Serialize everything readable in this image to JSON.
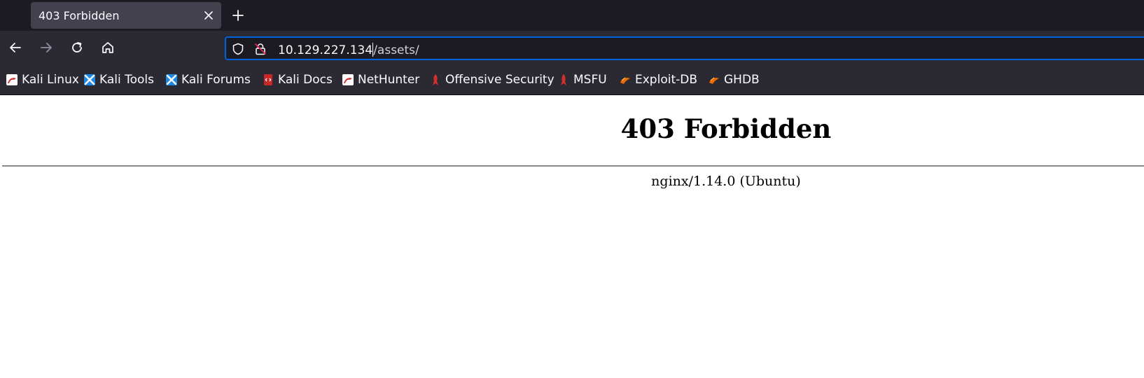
{
  "tab": {
    "title": "403 Forbidden"
  },
  "navbar": {
    "url_host": "10.129.227.134",
    "url_path": "/assets/"
  },
  "bookmarks": [
    {
      "label": "Kali Linux",
      "icon": "kali-dragon-icon"
    },
    {
      "label": "Kali Tools",
      "icon": "kali-tools-icon"
    },
    {
      "label": "Kali Forums",
      "icon": "kali-forums-icon"
    },
    {
      "label": "Kali Docs",
      "icon": "kali-docs-icon"
    },
    {
      "label": "NetHunter",
      "icon": "nethunter-icon"
    },
    {
      "label": "Offensive Security",
      "icon": "offsec-icon"
    },
    {
      "label": "MSFU",
      "icon": "msfu-icon"
    },
    {
      "label": "Exploit-DB",
      "icon": "exploit-db-icon"
    },
    {
      "label": "GHDB",
      "icon": "ghdb-icon"
    }
  ],
  "page": {
    "heading": "403 Forbidden",
    "server": "nginx/1.14.0 (Ubuntu)"
  },
  "colors": {
    "tabstrip": "#1c1b22",
    "toolbar": "#2b2a33",
    "active_tab": "#42414d",
    "focus_ring": "#0060df"
  }
}
